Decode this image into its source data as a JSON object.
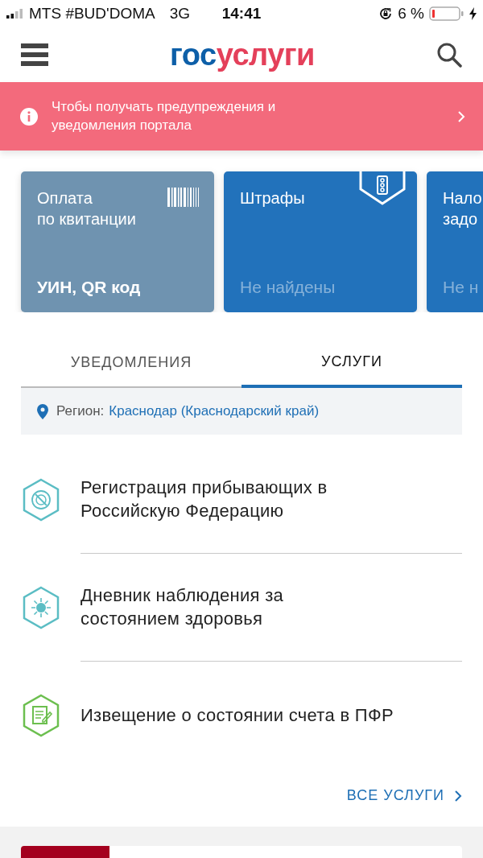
{
  "status_bar": {
    "carrier": "MTS #BUD'DOMA",
    "network": "3G",
    "time": "14:41",
    "battery": "6 %"
  },
  "header": {
    "logo_part_1": "гос",
    "logo_part_2": "услуги"
  },
  "banner": {
    "text": "Чтобы получать предупреждения и уведомления портала"
  },
  "cards": [
    {
      "kind": "payment",
      "title": "Оплата\nпо квитанции",
      "subtitle": "УИН, QR код"
    },
    {
      "kind": "fines",
      "title": "Штрафы",
      "subtitle": "Не найдены"
    },
    {
      "kind": "partial",
      "title": "Нало\nзадо",
      "subtitle": "Не н"
    }
  ],
  "tabs": [
    {
      "label": "УВЕДОМЛЕНИЯ",
      "selected": false
    },
    {
      "label": "УСЛУГИ",
      "selected": true
    }
  ],
  "region": {
    "label": "Регион:",
    "value": "Краснодар (Краснодарский край)"
  },
  "services": [
    {
      "kind": "registration",
      "title": "Регистрация прибывающих в Российскую Федерацию"
    },
    {
      "kind": "health",
      "title": "Дневник наблюдения за состоянием здоровья"
    },
    {
      "kind": "document",
      "title": "Извещение о состоянии счета в ПФР"
    }
  ],
  "all_services_link": "ВСЕ УСЛУГИ"
}
